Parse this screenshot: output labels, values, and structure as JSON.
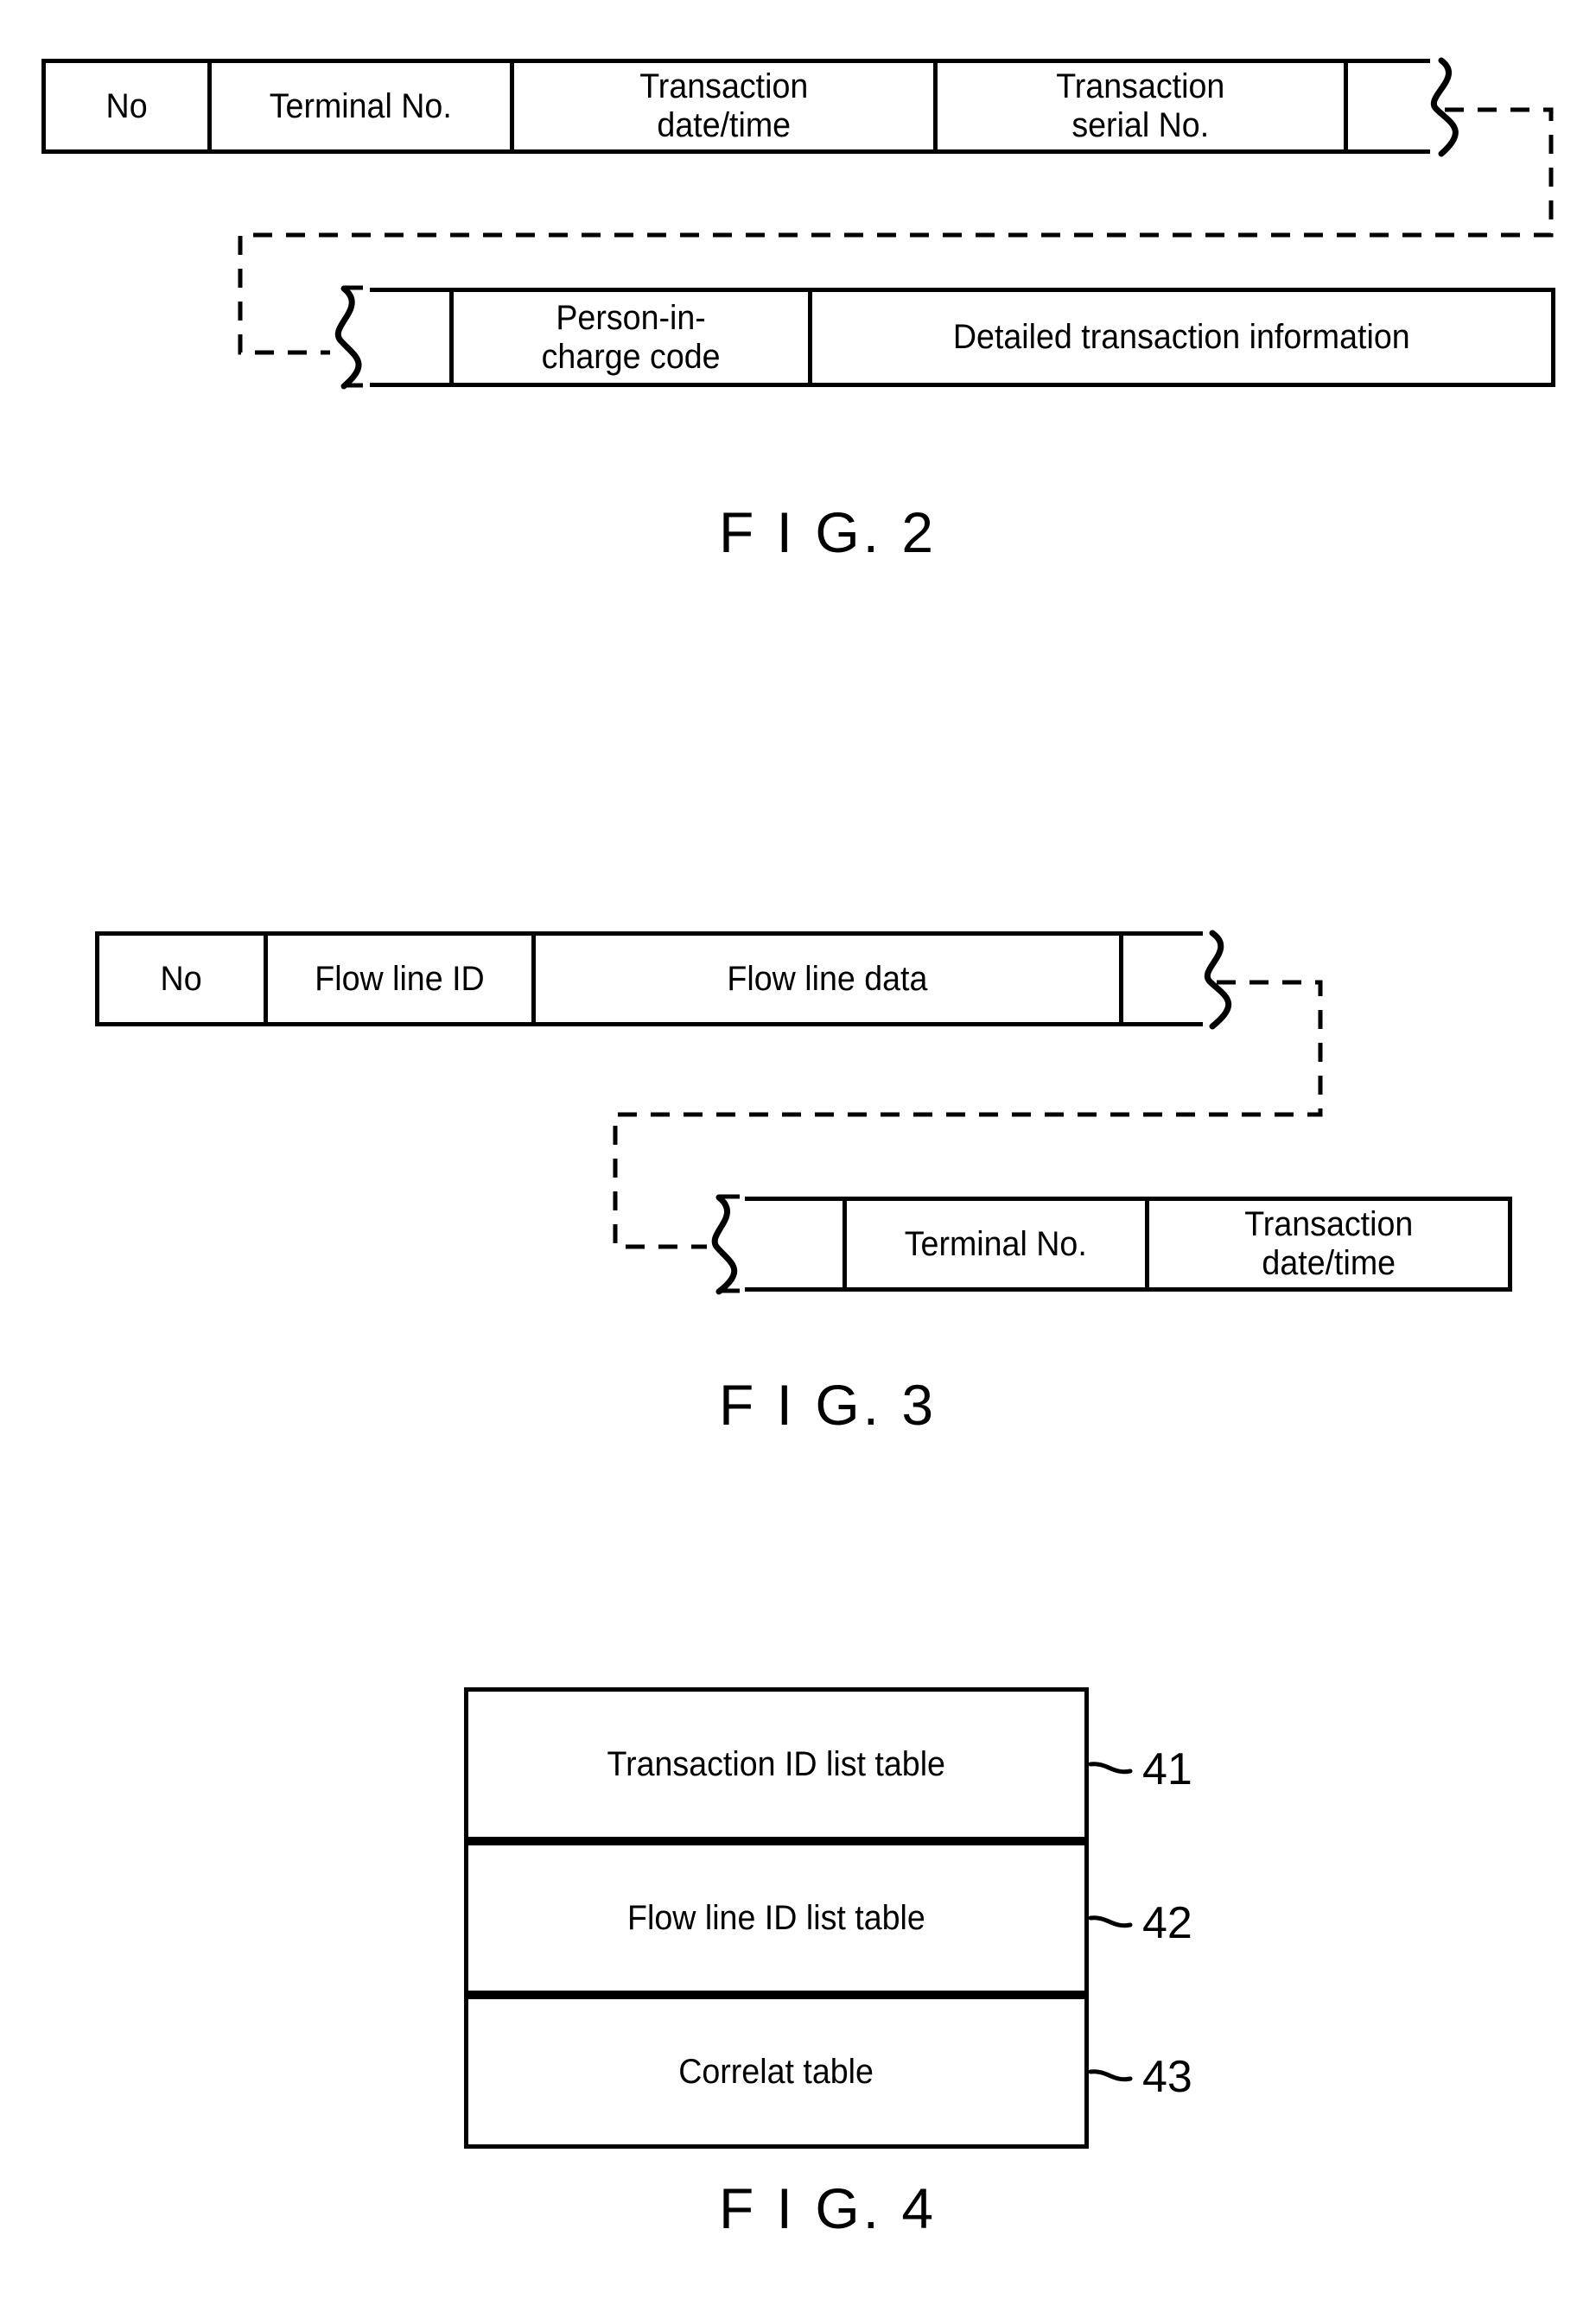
{
  "document": {
    "type": "patent-drawing-sheet",
    "background": "#ffffff",
    "ink": "#000000"
  },
  "figures": [
    {
      "id": "fig2",
      "caption": "F I G. 2",
      "description": "Transaction record layout split across two rows with a broken-edge continuation",
      "rows": [
        {
          "id": "fig2-row1",
          "cells": [
            {
              "label": "No"
            },
            {
              "label": "Terminal No."
            },
            {
              "label": "Transaction\ndate/time"
            },
            {
              "label": "Transaction\nserial No."
            },
            {
              "label": ""
            }
          ]
        },
        {
          "id": "fig2-row2",
          "cells": [
            {
              "label": ""
            },
            {
              "label": "Person-in-\ncharge code"
            },
            {
              "label": "Detailed transaction information"
            }
          ]
        }
      ]
    },
    {
      "id": "fig3",
      "caption": "F I G. 3",
      "description": "Flow line record layout split across two rows with a broken-edge continuation",
      "rows": [
        {
          "id": "fig3-row1",
          "cells": [
            {
              "label": "No"
            },
            {
              "label": "Flow line ID"
            },
            {
              "label": "Flow line data"
            },
            {
              "label": ""
            }
          ]
        },
        {
          "id": "fig3-row2",
          "cells": [
            {
              "label": ""
            },
            {
              "label": "Terminal No."
            },
            {
              "label": "Transaction\ndate/time"
            }
          ]
        }
      ]
    },
    {
      "id": "fig4",
      "caption": "F I G. 4",
      "description": "Stacked table block with reference numerals on leader lines",
      "blocks": [
        {
          "label": "Transaction ID list table",
          "ref": "41"
        },
        {
          "label": "Flow line ID list table",
          "ref": "42"
        },
        {
          "label": "Correlat table",
          "ref": "43"
        }
      ]
    }
  ]
}
